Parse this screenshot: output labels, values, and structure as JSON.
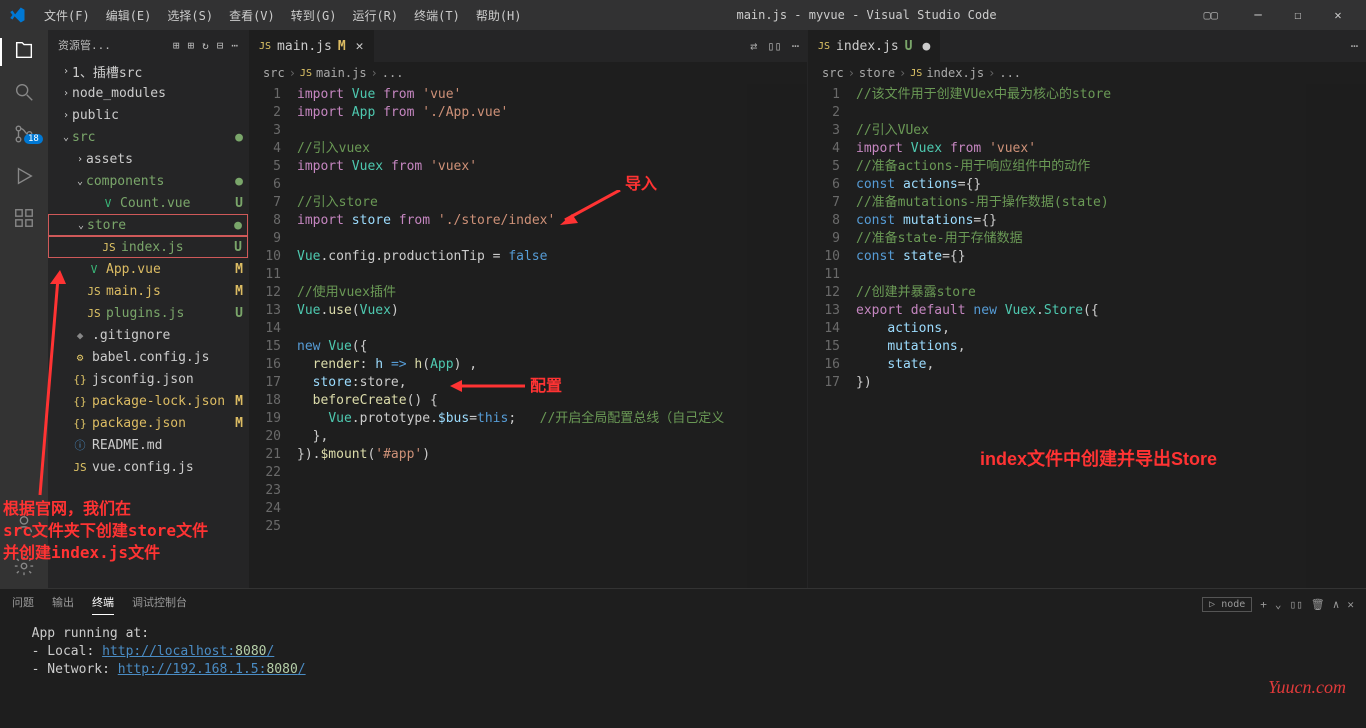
{
  "titlebar": {
    "menus": [
      "文件(F)",
      "编辑(E)",
      "选择(S)",
      "查看(V)",
      "转到(G)",
      "运行(R)",
      "终端(T)",
      "帮助(H)"
    ],
    "title": "main.js - myvue - Visual Studio Code"
  },
  "sidebar": {
    "header": "资源管...",
    "tree": [
      {
        "d": 0,
        "chev": ">",
        "name": "1、插槽src",
        "cls": ""
      },
      {
        "d": 0,
        "chev": ">",
        "name": "node_modules",
        "cls": ""
      },
      {
        "d": 0,
        "chev": ">",
        "name": "public",
        "cls": ""
      },
      {
        "d": 0,
        "chev": "v",
        "name": "src",
        "cls": "green",
        "dot": "●"
      },
      {
        "d": 1,
        "chev": ">",
        "name": "assets",
        "cls": ""
      },
      {
        "d": 1,
        "chev": "v",
        "name": "components",
        "cls": "green",
        "dot": "●"
      },
      {
        "d": 2,
        "icon": "V",
        "iconc": "#3aba7a",
        "name": "Count.vue",
        "cls": "green",
        "stat": "U"
      },
      {
        "d": 1,
        "chev": "v",
        "name": "store",
        "cls": "green",
        "dot": "●",
        "sel": true
      },
      {
        "d": 2,
        "icon": "JS",
        "iconc": "#e0c566",
        "name": "index.js",
        "cls": "green",
        "stat": "U",
        "sel": true
      },
      {
        "d": 1,
        "icon": "V",
        "iconc": "#3aba7a",
        "name": "App.vue",
        "cls": "yellow",
        "stat": "M"
      },
      {
        "d": 1,
        "icon": "JS",
        "iconc": "#e0c566",
        "name": "main.js",
        "cls": "yellow",
        "stat": "M"
      },
      {
        "d": 1,
        "icon": "JS",
        "iconc": "#e0c566",
        "name": "plugins.js",
        "cls": "green",
        "stat": "U"
      },
      {
        "d": 0,
        "icon": "◆",
        "iconc": "#888",
        "name": ".gitignore",
        "cls": ""
      },
      {
        "d": 0,
        "icon": "⚙",
        "iconc": "#e0c566",
        "name": "babel.config.js",
        "cls": ""
      },
      {
        "d": 0,
        "icon": "{}",
        "iconc": "#e0c566",
        "name": "jsconfig.json",
        "cls": ""
      },
      {
        "d": 0,
        "icon": "{}",
        "iconc": "#e0c566",
        "name": "package-lock.json",
        "cls": "yellow",
        "stat": "M"
      },
      {
        "d": 0,
        "icon": "{}",
        "iconc": "#e0c566",
        "name": "package.json",
        "cls": "yellow",
        "stat": "M"
      },
      {
        "d": 0,
        "icon": "ⓘ",
        "iconc": "#4a8cc4",
        "name": "README.md",
        "cls": ""
      },
      {
        "d": 0,
        "icon": "JS",
        "iconc": "#e0c566",
        "name": "vue.config.js",
        "cls": ""
      }
    ]
  },
  "editor1": {
    "tab": {
      "icon": "JS",
      "name": "main.js",
      "mod": "M",
      "modc": "yellow"
    },
    "crumbs": [
      "src",
      "main.js",
      "..."
    ],
    "crumbsicon": "JS",
    "lines": [
      [
        1,
        [
          [
            "k-imp",
            "import"
          ],
          [
            "",
            " "
          ],
          [
            "k-var",
            "Vue"
          ],
          [
            "",
            " "
          ],
          [
            "k-from",
            "from"
          ],
          [
            "",
            " "
          ],
          [
            "k-str",
            "'vue'"
          ]
        ]
      ],
      [
        2,
        [
          [
            "k-imp",
            "import"
          ],
          [
            "",
            " "
          ],
          [
            "k-var",
            "App"
          ],
          [
            "",
            " "
          ],
          [
            "k-from",
            "from"
          ],
          [
            "",
            " "
          ],
          [
            "k-str",
            "'./App.vue'"
          ]
        ]
      ],
      [
        3,
        [
          [
            "",
            ""
          ]
        ],
        true
      ],
      [
        4,
        [
          [
            "k-cmt",
            "//引入vuex"
          ]
        ]
      ],
      [
        5,
        [
          [
            "k-imp",
            "import"
          ],
          [
            "",
            " "
          ],
          [
            "k-var",
            "Vuex"
          ],
          [
            "",
            " "
          ],
          [
            "k-from",
            "from"
          ],
          [
            "",
            " "
          ],
          [
            "k-str",
            "'vuex'"
          ]
        ]
      ],
      [
        6,
        [
          [
            "",
            ""
          ]
        ],
        true
      ],
      [
        7,
        [
          [
            "k-cmt",
            "//引入store"
          ]
        ]
      ],
      [
        8,
        [
          [
            "k-imp",
            "import"
          ],
          [
            "",
            " "
          ],
          [
            "k-lb",
            "store"
          ],
          [
            "",
            " "
          ],
          [
            "k-from",
            "from"
          ],
          [
            "",
            " "
          ],
          [
            "k-str",
            "'./store/index'"
          ]
        ]
      ],
      [
        9,
        [
          [
            "",
            ""
          ]
        ],
        true
      ],
      [
        10,
        [
          [
            "k-var",
            "Vue"
          ],
          [
            "",
            ".config.productionTip = "
          ],
          [
            "k-blue",
            "false"
          ]
        ]
      ],
      [
        11,
        [
          [
            "",
            ""
          ]
        ],
        true
      ],
      [
        12,
        [
          [
            "k-cmt",
            "//使用vuex插件"
          ]
        ]
      ],
      [
        13,
        [
          [
            "k-var",
            "Vue"
          ],
          [
            "",
            "."
          ],
          [
            "k-yel",
            "use"
          ],
          [
            "",
            "("
          ],
          [
            "k-var",
            "Vuex"
          ],
          [
            "",
            ")"
          ]
        ]
      ],
      [
        14,
        [
          [
            "",
            ""
          ]
        ]
      ],
      [
        15,
        [
          [
            "k-blue",
            "new"
          ],
          [
            "",
            " "
          ],
          [
            "k-var",
            "Vue"
          ],
          [
            "",
            "({"
          ]
        ]
      ],
      [
        16,
        [
          [
            "",
            "  "
          ],
          [
            "k-yel",
            "render"
          ],
          [
            "",
            ": "
          ],
          [
            "k-lb",
            "h"
          ],
          [
            "",
            " "
          ],
          [
            "k-blue",
            "=>"
          ],
          [
            "",
            " "
          ],
          [
            "k-yel",
            "h"
          ],
          [
            "",
            "("
          ],
          [
            "k-var",
            "App"
          ],
          [
            "",
            ") ,"
          ]
        ]
      ],
      [
        17,
        [
          [
            "",
            "  "
          ],
          [
            "k-lb",
            "store"
          ],
          [
            "",
            ":store,"
          ]
        ]
      ],
      [
        18,
        [
          [
            "",
            "  "
          ],
          [
            "k-yel",
            "beforeCreate"
          ],
          [
            "",
            "() {"
          ]
        ]
      ],
      [
        19,
        [
          [
            "",
            "    "
          ],
          [
            "k-var",
            "Vue"
          ],
          [
            "",
            ".prototype."
          ],
          [
            "k-lb",
            "$bus"
          ],
          [
            "",
            "="
          ],
          [
            "k-blue",
            "this"
          ],
          [
            "",
            ";   "
          ],
          [
            "k-cmt",
            "//开启全局配置总线（自己定义"
          ]
        ]
      ],
      [
        20,
        [
          [
            "",
            "  },"
          ]
        ]
      ],
      [
        21,
        [
          [
            "",
            "})."
          ],
          [
            "k-yel",
            "$mount"
          ],
          [
            "",
            "("
          ],
          [
            "k-str",
            "'#app'"
          ],
          [
            "",
            ")"
          ]
        ]
      ],
      [
        22,
        [
          [
            "",
            ""
          ]
        ]
      ],
      [
        23,
        [
          [
            "",
            ""
          ]
        ]
      ],
      [
        24,
        [
          [
            "",
            ""
          ]
        ]
      ],
      [
        25,
        [
          [
            "",
            ""
          ]
        ]
      ]
    ]
  },
  "editor2": {
    "tab": {
      "icon": "JS",
      "name": "index.js",
      "mod": "U",
      "modc": "green"
    },
    "crumbs": [
      "src",
      "store",
      "index.js",
      "..."
    ],
    "crumbsicon": "JS",
    "lines": [
      [
        1,
        [
          [
            "k-cmt",
            "//该文件用于创建VUex中最为核心的store"
          ]
        ]
      ],
      [
        2,
        [
          [
            "",
            ""
          ]
        ]
      ],
      [
        3,
        [
          [
            "k-cmt",
            "//引入VUex"
          ]
        ]
      ],
      [
        4,
        [
          [
            "k-imp",
            "import"
          ],
          [
            "",
            " "
          ],
          [
            "k-var",
            "Vuex"
          ],
          [
            "",
            " "
          ],
          [
            "k-from",
            "from"
          ],
          [
            "",
            " "
          ],
          [
            "k-str",
            "'vuex'"
          ]
        ]
      ],
      [
        5,
        [
          [
            "k-cmt",
            "//准备actions-用于响应组件中的动作"
          ]
        ]
      ],
      [
        6,
        [
          [
            "k-blue",
            "const"
          ],
          [
            "",
            " "
          ],
          [
            "k-lb",
            "actions"
          ],
          [
            "",
            "={}"
          ]
        ]
      ],
      [
        7,
        [
          [
            "k-cmt",
            "//准备mutations-用于操作数据(state)"
          ]
        ]
      ],
      [
        8,
        [
          [
            "k-blue",
            "const"
          ],
          [
            "",
            " "
          ],
          [
            "k-lb",
            "mutations"
          ],
          [
            "",
            "={}"
          ]
        ]
      ],
      [
        9,
        [
          [
            "k-cmt",
            "//准备state-用于存储数据"
          ]
        ]
      ],
      [
        10,
        [
          [
            "k-blue",
            "const"
          ],
          [
            "",
            " "
          ],
          [
            "k-lb",
            "state"
          ],
          [
            "",
            "={}"
          ]
        ]
      ],
      [
        11,
        [
          [
            "",
            ""
          ]
        ]
      ],
      [
        12,
        [
          [
            "k-cmt",
            "//创建并暴露store"
          ]
        ]
      ],
      [
        13,
        [
          [
            "k-imp",
            "export"
          ],
          [
            "",
            " "
          ],
          [
            "k-imp",
            "default"
          ],
          [
            "",
            " "
          ],
          [
            "k-blue",
            "new"
          ],
          [
            "",
            " "
          ],
          [
            "k-var",
            "Vuex"
          ],
          [
            "",
            "."
          ],
          [
            "k-var",
            "Store"
          ],
          [
            "",
            "({"
          ]
        ]
      ],
      [
        14,
        [
          [
            "",
            "    "
          ],
          [
            "k-lb",
            "actions"
          ],
          [
            "",
            ","
          ]
        ]
      ],
      [
        15,
        [
          [
            "",
            "    "
          ],
          [
            "k-lb",
            "mutations"
          ],
          [
            "",
            ","
          ]
        ]
      ],
      [
        16,
        [
          [
            "",
            "    "
          ],
          [
            "k-lb",
            "state"
          ],
          [
            "",
            ","
          ]
        ]
      ],
      [
        17,
        [
          [
            "",
            "})"
          ]
        ]
      ]
    ]
  },
  "panel": {
    "tabs": [
      "问题",
      "输出",
      "终端",
      "调试控制台"
    ],
    "active": 2,
    "right_label": "node",
    "body": {
      "l1": "App running at:",
      "l2a": "- Local:   ",
      "l2b": "http://localhost:",
      "l2c": "8080",
      "l2d": "/",
      "l3a": "- Network: ",
      "l3b": "http://192.168.1.5:",
      "l3c": "8080",
      "l3d": "/"
    }
  },
  "annotations": {
    "a1": "导入",
    "a2": "配置",
    "a3l1": "根据官网，我们在",
    "a3l2": "src文件夹下创建store文件",
    "a3l3": "并创建index.js文件",
    "a4": "index文件中创建并导出Store"
  },
  "watermark": "Yuucn.com",
  "scm_badge": "18"
}
